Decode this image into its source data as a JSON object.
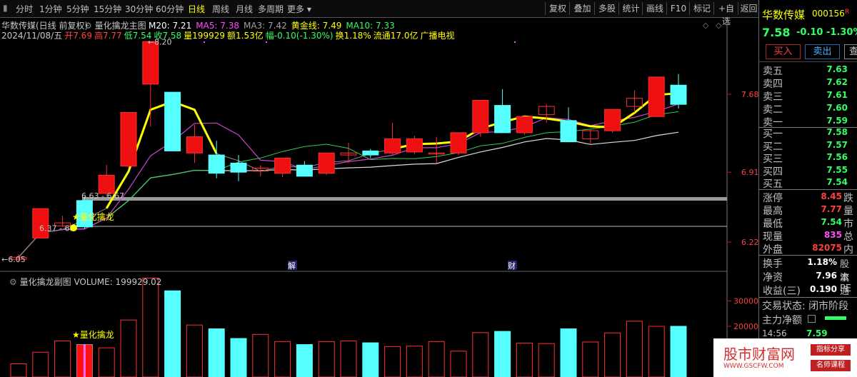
{
  "toolbar": {
    "menu": "▮",
    "periods": [
      "分时",
      "1分钟",
      "5分钟",
      "15分钟",
      "30分钟",
      "60分钟",
      "日线",
      "周线",
      "月线",
      "多周期",
      "更多 ▾"
    ],
    "active_index": 6,
    "right_buttons": [
      "复权",
      "叠加",
      "多股",
      "统计",
      "画线",
      "F10",
      "标记",
      "+自选",
      "返回"
    ]
  },
  "main": {
    "title": "华数传媒(日线 前复权)",
    "indicator": "量化擒龙主图",
    "ma": [
      {
        "label": "M20: 7.21",
        "color": "#ffffff"
      },
      {
        "label": "MA5: 7.38",
        "color": "#ff4dff"
      },
      {
        "label": "MA3: 7.42",
        "color": "#a0a0a0"
      },
      {
        "label": "黄金线: 7.49",
        "color": "#ffff00"
      },
      {
        "label": "MA10: 7.33",
        "color": "#33ff66"
      }
    ],
    "quote": {
      "date": "2024/11/08/五",
      "open_lab": "开",
      "open": "7.69",
      "high_lab": "高",
      "high": "7.77",
      "low_lab": "低",
      "low": "7.54",
      "close_lab": "收",
      "close": "7.58",
      "vol_lab": "量",
      "vol": "199929",
      "amt_lab": "额",
      "amt": "1.53亿",
      "chg_lab": "幅",
      "chg": "-0.10(-1.30%)",
      "turn_lab": "换",
      "turn": "1.18%",
      "float_lab": "流通",
      "float": "17.0亿",
      "sector": "广播电视"
    },
    "price_axis": [
      "7.68",
      "6.91",
      "6.22"
    ],
    "annotations": {
      "high": "8.20",
      "low": "6.05",
      "range1": "6.63 - 6.67",
      "range2": "6.37 - 6.",
      "signal": "量化擒龙",
      "marker_jie": "解",
      "marker_cai": "财"
    }
  },
  "sub": {
    "title": "量化擒龙副图",
    "volume_label": "VOLUME: 199929.02",
    "axis": [
      "30000",
      "20000"
    ],
    "signal": "量化擒龙"
  },
  "chart_data": {
    "type": "candlestick",
    "candles": [
      {
        "o": 6.05,
        "h": 6.1,
        "l": 6.02,
        "c": 6.07
      },
      {
        "o": 6.26,
        "h": 6.55,
        "l": 6.26,
        "c": 6.55
      },
      {
        "o": 6.38,
        "h": 6.48,
        "l": 6.37,
        "c": 6.41
      },
      {
        "o": 6.63,
        "h": 6.67,
        "l": 6.35,
        "c": 6.37
      },
      {
        "o": 6.7,
        "h": 6.98,
        "l": 6.67,
        "c": 6.88
      },
      {
        "o": 6.97,
        "h": 7.5,
        "l": 6.95,
        "c": 7.5
      },
      {
        "o": 7.78,
        "h": 8.2,
        "l": 7.36,
        "c": 8.2
      },
      {
        "o": 7.7,
        "h": 7.7,
        "l": 7.12,
        "c": 7.12
      },
      {
        "o": 7.1,
        "h": 7.38,
        "l": 7.0,
        "c": 7.26
      },
      {
        "o": 7.08,
        "h": 7.22,
        "l": 6.85,
        "c": 6.9
      },
      {
        "o": 7.0,
        "h": 7.08,
        "l": 6.82,
        "c": 6.91
      },
      {
        "o": 6.92,
        "h": 6.98,
        "l": 6.87,
        "c": 6.95
      },
      {
        "o": 6.9,
        "h": 7.05,
        "l": 6.86,
        "c": 7.05
      },
      {
        "o": 6.98,
        "h": 7.02,
        "l": 6.88,
        "c": 6.87
      },
      {
        "o": 6.9,
        "h": 7.1,
        "l": 6.88,
        "c": 7.1
      },
      {
        "o": 7.08,
        "h": 7.2,
        "l": 7.0,
        "c": 7.1
      },
      {
        "o": 7.12,
        "h": 7.14,
        "l": 7.05,
        "c": 7.08
      },
      {
        "o": 7.1,
        "h": 7.4,
        "l": 7.08,
        "c": 7.24
      },
      {
        "o": 7.11,
        "h": 7.27,
        "l": 7.09,
        "c": 7.24
      },
      {
        "o": 7.1,
        "h": 7.26,
        "l": 7.0,
        "c": 7.1
      },
      {
        "o": 7.1,
        "h": 7.3,
        "l": 7.08,
        "c": 7.3
      },
      {
        "o": 7.3,
        "h": 7.62,
        "l": 7.26,
        "c": 7.62
      },
      {
        "o": 7.57,
        "h": 7.73,
        "l": 7.33,
        "c": 7.3
      },
      {
        "o": 7.3,
        "h": 7.44,
        "l": 7.28,
        "c": 7.46
      },
      {
        "o": 7.48,
        "h": 7.58,
        "l": 7.4,
        "c": 7.56
      },
      {
        "o": 7.42,
        "h": 7.55,
        "l": 7.22,
        "c": 7.21
      },
      {
        "o": 7.24,
        "h": 7.33,
        "l": 7.19,
        "c": 7.32
      },
      {
        "o": 7.32,
        "h": 7.5,
        "l": 7.3,
        "c": 7.53
      },
      {
        "o": 7.56,
        "h": 7.72,
        "l": 7.5,
        "c": 7.64
      },
      {
        "o": 7.46,
        "h": 7.85,
        "l": 7.46,
        "c": 7.85
      },
      {
        "o": 7.77,
        "h": 7.88,
        "l": 7.54,
        "c": 7.58
      }
    ],
    "volume": [
      5200,
      9800,
      14200,
      12800,
      11500,
      22500,
      39000,
      34000,
      20500,
      19000,
      15200,
      16800,
      14000,
      12800,
      14000,
      14200,
      13500,
      12000,
      12200,
      14000,
      10200,
      17500,
      18000,
      13400,
      13200,
      19000,
      13800,
      17400,
      22000,
      20000,
      20000
    ]
  },
  "panel": {
    "name": "华数传媒",
    "code": "000156",
    "price": "7.58",
    "chg": "-0.10",
    "pct": "-1.30%",
    "buy_btn": "买入",
    "sell_btn": "卖出",
    "extra_btn": "查",
    "sells": [
      {
        "lab": "卖五",
        "price": "7.63"
      },
      {
        "lab": "卖四",
        "price": "7.62"
      },
      {
        "lab": "卖三",
        "price": "7.61"
      },
      {
        "lab": "卖二",
        "price": "7.60"
      },
      {
        "lab": "卖一",
        "price": "7.59"
      }
    ],
    "buys": [
      {
        "lab": "买一",
        "price": "7.58"
      },
      {
        "lab": "买二",
        "price": "7.57"
      },
      {
        "lab": "买三",
        "price": "7.56"
      },
      {
        "lab": "买四",
        "price": "7.55"
      },
      {
        "lab": "买五",
        "price": "7.54"
      }
    ],
    "stats": [
      {
        "lab": "涨停",
        "val": "8.45",
        "tail": "跌",
        "color": "#ff4040"
      },
      {
        "lab": "最高",
        "val": "7.77",
        "tail": "量",
        "color": "#ff4040"
      },
      {
        "lab": "最低",
        "val": "7.54",
        "tail": "市",
        "color": "#33ff66"
      },
      {
        "lab": "现量",
        "val": "835",
        "tail": "总",
        "color": "#ff4dff"
      },
      {
        "lab": "外盘",
        "val": "82075",
        "tail": "内",
        "color": "#ff4040"
      }
    ],
    "stats2": [
      {
        "lab": "换手",
        "val": "1.18%",
        "tail": "股本"
      },
      {
        "lab": "净资",
        "val": "7.96",
        "tail": "流通"
      },
      {
        "lab": "收益(三)",
        "val": "0.190",
        "tail": "PE"
      }
    ],
    "trade_state": "交易状态: 闭市阶段",
    "fund_label": "主力净额",
    "tick_time": "14:56",
    "tick_price": "7.59"
  },
  "watermark": {
    "name": "股市财富网",
    "url": "WWW.GSCFW.COM",
    "tag1": "指标分享",
    "tag2": "名师课程"
  }
}
